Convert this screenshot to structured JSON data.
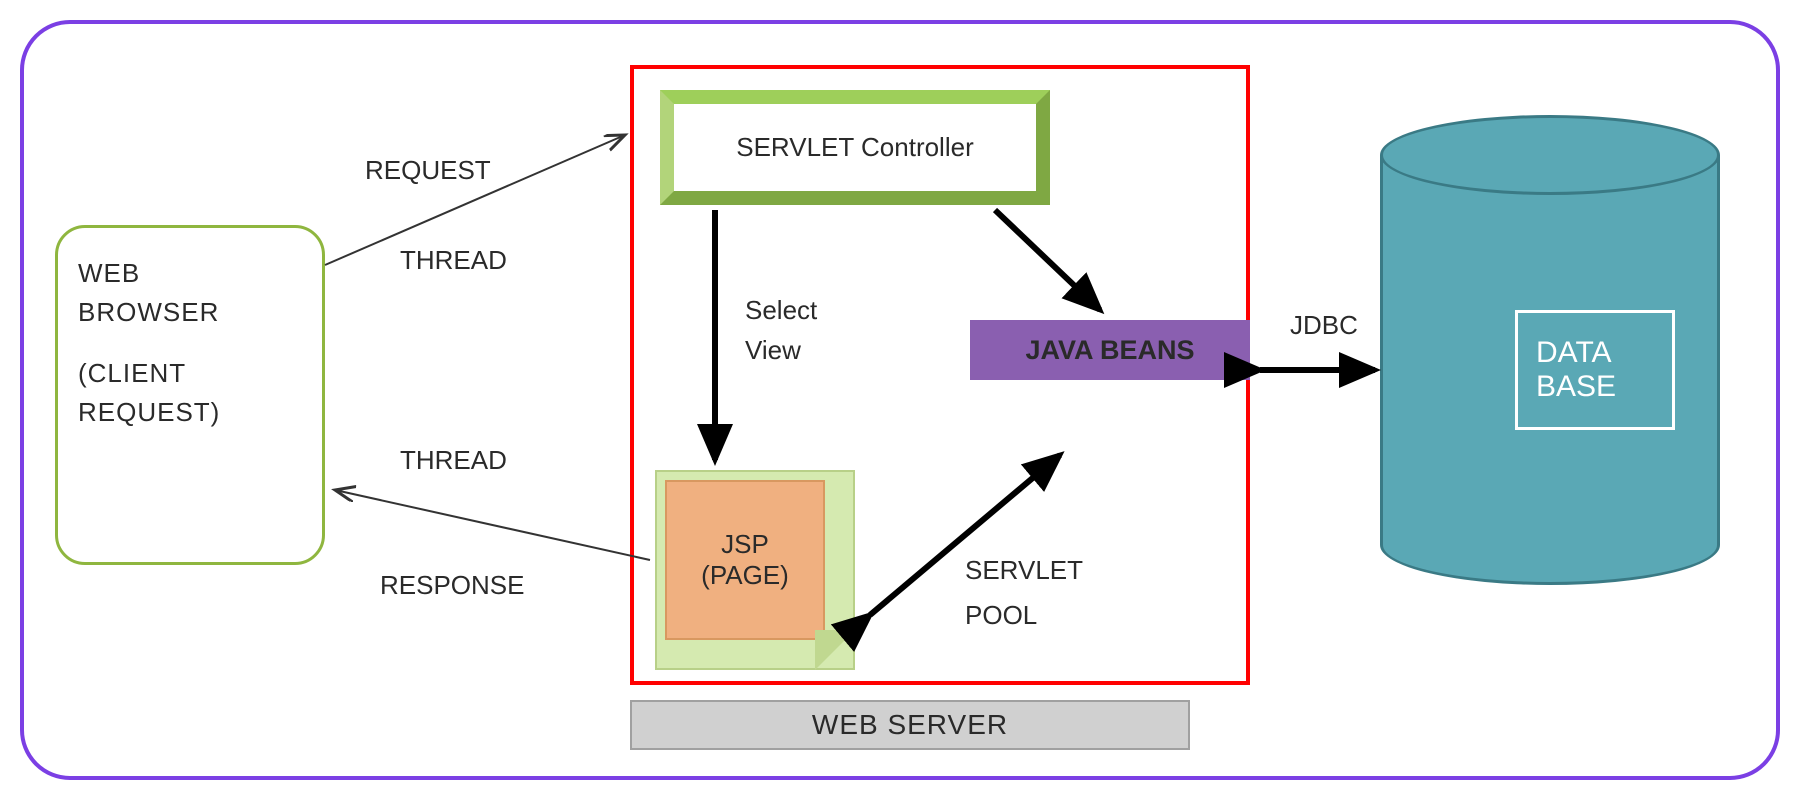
{
  "browser": {
    "line1": "WEB",
    "line2": "BROWSER",
    "line3": "(CLIENT",
    "line4": "REQUEST)"
  },
  "labels": {
    "request": "REQUEST",
    "thread1": "THREAD",
    "thread2": "THREAD",
    "response": "RESPONSE",
    "selectView1": "Select",
    "selectView2": "View",
    "jdbc": "JDBC",
    "servletPool1": "SERVLET",
    "servletPool2": "POOL",
    "webserver": "WEB SERVER"
  },
  "boxes": {
    "servlet": "SERVLET Controller",
    "jsp1": "JSP",
    "jsp2": "(PAGE)",
    "beans": "JAVA BEANS",
    "db1": "DATA",
    "db2": "BASE"
  }
}
